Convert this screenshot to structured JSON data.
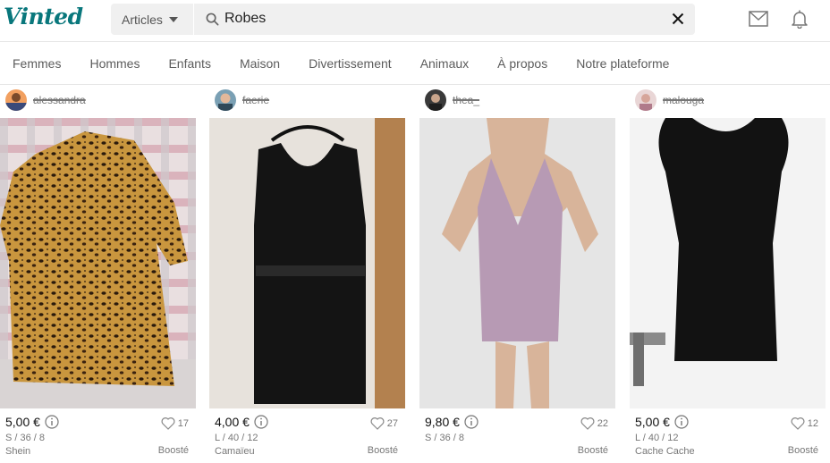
{
  "header": {
    "logo": "Vinted",
    "category_select": "Articles",
    "search_value": "Robes"
  },
  "nav": {
    "categories": [
      "Femmes",
      "Hommes",
      "Enfants",
      "Maison",
      "Divertissement",
      "Animaux",
      "À propos",
      "Notre plateforme"
    ]
  },
  "items": [
    {
      "username": "alessandra",
      "price": "5,00 €",
      "likes": "17",
      "size": "S / 36 / 8",
      "brand": "Shein",
      "badge": "Boosté"
    },
    {
      "username": "faerie",
      "price": "4,00 €",
      "likes": "27",
      "size": "L / 40 / 12",
      "brand": "Camaïeu",
      "badge": "Boosté"
    },
    {
      "username": "thea_",
      "price": "9,80 €",
      "likes": "22",
      "size": "S / 36 / 8",
      "brand": "",
      "badge": "Boosté"
    },
    {
      "username": "malouga",
      "price": "5,00 €",
      "likes": "12",
      "size": "L / 40 / 12",
      "brand": "Cache Cache",
      "badge": "Boosté"
    }
  ],
  "colors": {
    "brand": "#09777c",
    "muted_text": "#777777",
    "search_bg": "#f0f0f0"
  },
  "icons": [
    "search-icon",
    "clear-icon",
    "mail-icon",
    "bell-icon",
    "info-icon",
    "heart-icon",
    "chevron-down-icon"
  ]
}
